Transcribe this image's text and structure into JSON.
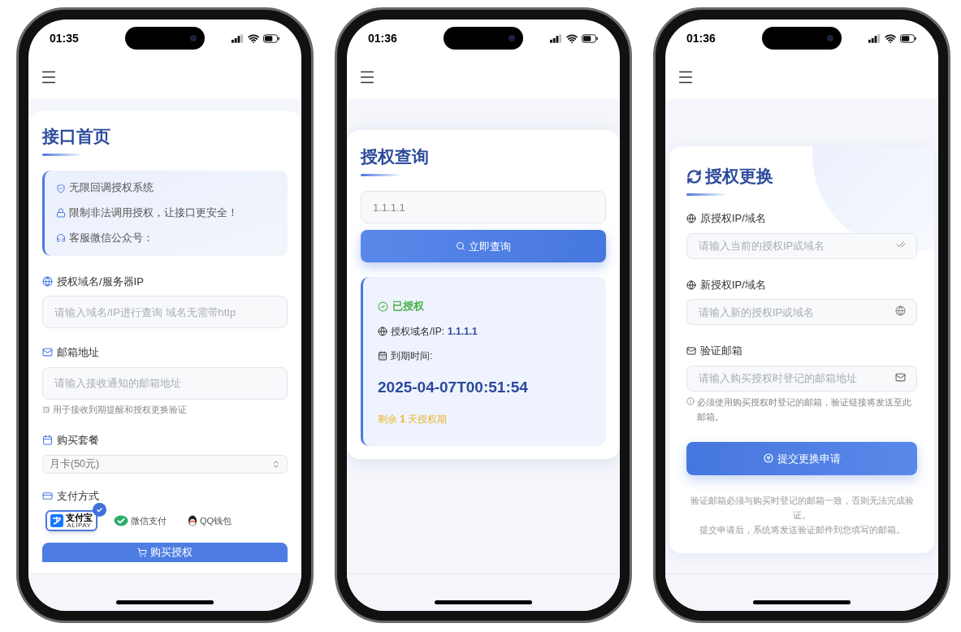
{
  "phones": [
    {
      "kind": "purchase",
      "time": "01:35",
      "title": "接口首页",
      "notices": [
        "无限回调授权系统",
        "限制非法调用授权，让接口更安全！",
        "客服微信公众号："
      ],
      "fields": [
        {
          "label": "授权域名/服务器IP",
          "placeholder": "请输入域名/IP进行查询 域名无需带http"
        },
        {
          "label": "邮箱地址",
          "placeholder": "请输入接收通知的邮箱地址",
          "hint": "用于接收到期提醒和授权更换验证"
        }
      ],
      "package": {
        "label": "购买套餐",
        "value": "月卡(50元)"
      },
      "payment": {
        "label": "支付方式",
        "options": [
          {
            "label": "支付宝",
            "sublabel": "ALIPAY",
            "selected": true
          },
          {
            "label": "微信支付",
            "selected": false
          },
          {
            "label": "QQ钱包",
            "selected": false
          }
        ]
      },
      "submit": "购买授权"
    },
    {
      "kind": "query",
      "time": "01:36",
      "title": "授权查询",
      "query": {
        "value": "1.1.1.1"
      },
      "button": "立即查询",
      "result": {
        "status": "已授权",
        "domain_label": "授权域名/IP:",
        "domain_value": "1.1.1.1",
        "expiry_label": "到期时间:",
        "expiry_value": "2025-04-07T00:51:54",
        "remaining": "剩余 **1** 天授权期"
      }
    },
    {
      "kind": "change",
      "time": "01:36",
      "title": "授权更换",
      "fields": [
        {
          "label": "原授权IP/域名",
          "placeholder": "请输入当前的授权IP或域名"
        },
        {
          "label": "新授权IP/域名",
          "placeholder": "请输入新的授权IP或域名"
        },
        {
          "label": "验证邮箱",
          "placeholder": "请输入购买授权时登记的邮箱地址",
          "hint": "必须使用购买授权时登记的邮箱，验证链接将发送至此邮箱。"
        }
      ],
      "button": "提交更换申请",
      "notes": [
        "验证邮箱必须与购买时登记的邮箱一致，否则无法完成验证。",
        "提交申请后，系统将发送验证邮件到您填写的邮箱。"
      ]
    }
  ]
}
